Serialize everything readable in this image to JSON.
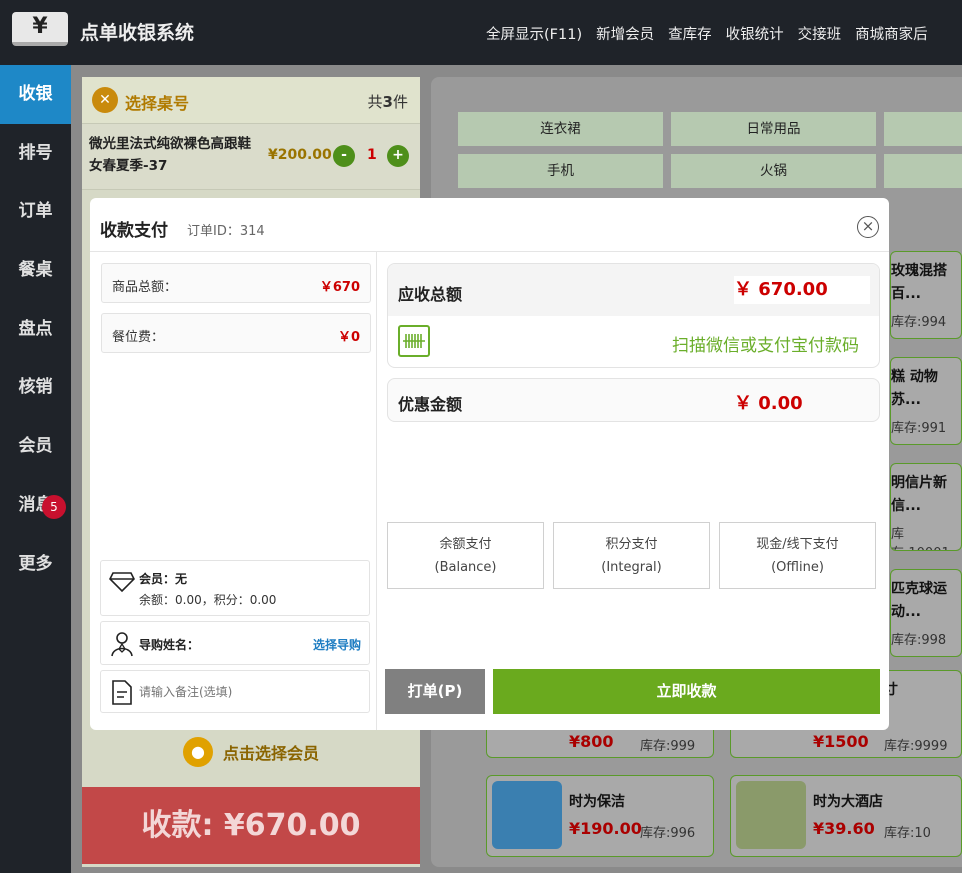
{
  "header": {
    "logo": "¥",
    "app_title": "点单收银系统",
    "nav": [
      "全屏显示(F11)",
      "新增会员",
      "查库存",
      "收银统计",
      "交接班",
      "商城商家后"
    ]
  },
  "sidebar": {
    "items": [
      {
        "label": "收银",
        "active": true
      },
      {
        "label": "排号"
      },
      {
        "label": "订单"
      },
      {
        "label": "餐桌"
      },
      {
        "label": "盘点"
      },
      {
        "label": "核销"
      },
      {
        "label": "会员"
      },
      {
        "label": "消息",
        "badge": "5"
      },
      {
        "label": "更多"
      }
    ]
  },
  "cart": {
    "title": "选择桌号",
    "count_prefix": "共",
    "count": "3",
    "count_suffix": "件",
    "items": [
      {
        "name": "微光里法式纯欲裸色高跟鞋女春夏季-37",
        "price": "¥200.00",
        "qty": "1",
        "minus": "-",
        "plus": "+"
      }
    ],
    "member_prompt": "点击选择会员",
    "pay_total": "收款: ¥670.00"
  },
  "categories": {
    "row1": [
      "连衣裙",
      "日常用品",
      ""
    ],
    "row2": [
      "手机",
      "火锅",
      ""
    ]
  },
  "products": [
    {
      "name": "玫瑰混搭百...",
      "stock": "库存:994"
    },
    {
      "name": "糕 动物苏...",
      "stock": "库存:991"
    },
    {
      "name": "明信片新信...",
      "stock": "库存:10001"
    },
    {
      "name": "匹克球运动...",
      "stock": "库存:998"
    },
    {
      "name": "寸",
      "price": "¥800",
      "stock": "库存:999",
      "price2": "¥1500",
      "stock2": "库存:9999"
    },
    {
      "name": "时为保洁",
      "price": "¥190.00",
      "stock": "库存:996"
    },
    {
      "name": "时为大酒店",
      "price": "¥39.60",
      "stock": "库存:10"
    }
  ],
  "modal": {
    "title": "收款支付",
    "order_id": "订单ID：314",
    "close": "×",
    "summary": [
      {
        "label": "商品总额：",
        "value": "￥670"
      },
      {
        "label": "餐位费：",
        "value": "￥0"
      }
    ],
    "member": {
      "label": "会员：无",
      "detail": "余额：0.00，积分：0.00"
    },
    "guide": {
      "label": "导购姓名：",
      "action": "选择导购"
    },
    "remark_placeholder": "请输入备注(选填)",
    "due_label": "应收总额",
    "due_value": "￥ 670.00",
    "scan_text": "扫描微信或支付宝付款码",
    "discount_label": "优惠金额",
    "discount_value": "￥ 0.00",
    "pay_options": [
      {
        "line1": "余额支付",
        "line2": "(Balance)"
      },
      {
        "line1": "积分支付",
        "line2": "(Integral)"
      },
      {
        "line1": "现金/线下支付",
        "line2": "(Offline)"
      }
    ],
    "print_button": "打单(P)",
    "pay_button": "立即收款"
  },
  "colors": {
    "accent": "#1e88c7",
    "pay_green": "#6aaa1e",
    "danger": "#c8102e",
    "price_red": "#cc0000"
  }
}
